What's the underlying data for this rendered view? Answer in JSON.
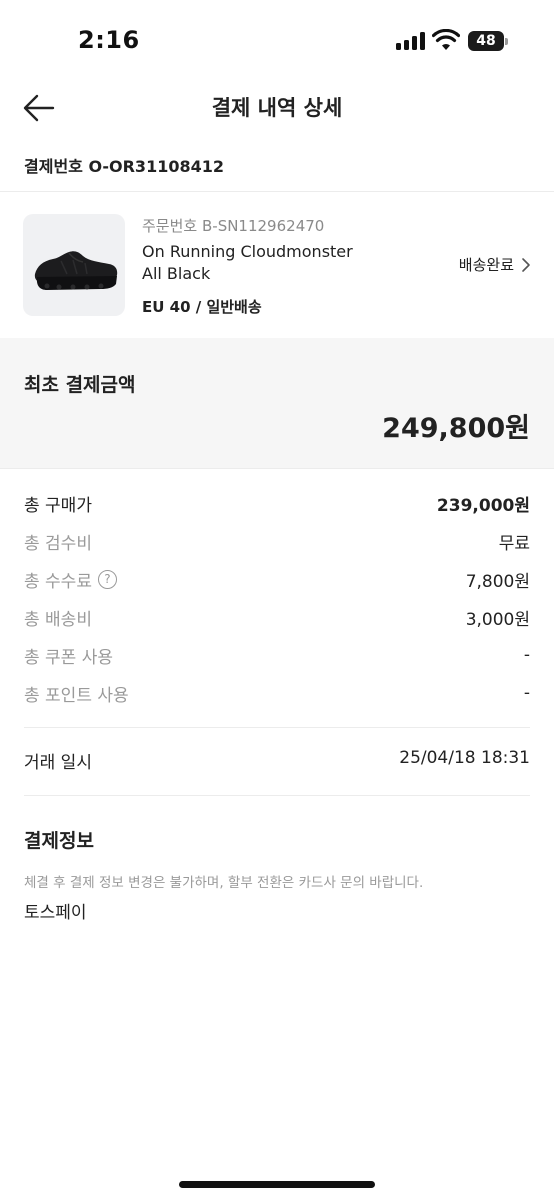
{
  "status_bar": {
    "time": "2:16",
    "battery": "48"
  },
  "header": {
    "title": "결제 내역 상세"
  },
  "payment": {
    "label": "결제번호",
    "number": "O-OR31108412"
  },
  "product": {
    "order_label": "주문번호",
    "order_number": "B-SN112962470",
    "name_line1": "On Running Cloudmonster",
    "name_line2": "All Black",
    "option": "EU 40 / 일반배송",
    "status": "배송완료"
  },
  "total": {
    "label": "최초 결제금액",
    "amount": "249,800원"
  },
  "breakdown": [
    {
      "label": "총 구매가",
      "value": "239,000원"
    },
    {
      "label": "총 검수비",
      "value": "무료"
    },
    {
      "label": "총 수수료",
      "value": "7,800원"
    },
    {
      "label": "총 배송비",
      "value": "3,000원"
    },
    {
      "label": "총 쿠폰 사용",
      "value": "-"
    },
    {
      "label": "총 포인트 사용",
      "value": "-"
    }
  ],
  "trade": {
    "label": "거래 일시",
    "value": "25/04/18 18:31"
  },
  "pay_info": {
    "title": "결제정보",
    "note": "체결 후 결제 정보 변경은 불가하며, 할부 전환은 카드사 문의 바랍니다.",
    "method": "토스페이"
  },
  "icons": {
    "back": "arrow-left-icon",
    "chevron": "chevron-right-icon",
    "help": "question-circle-icon"
  }
}
